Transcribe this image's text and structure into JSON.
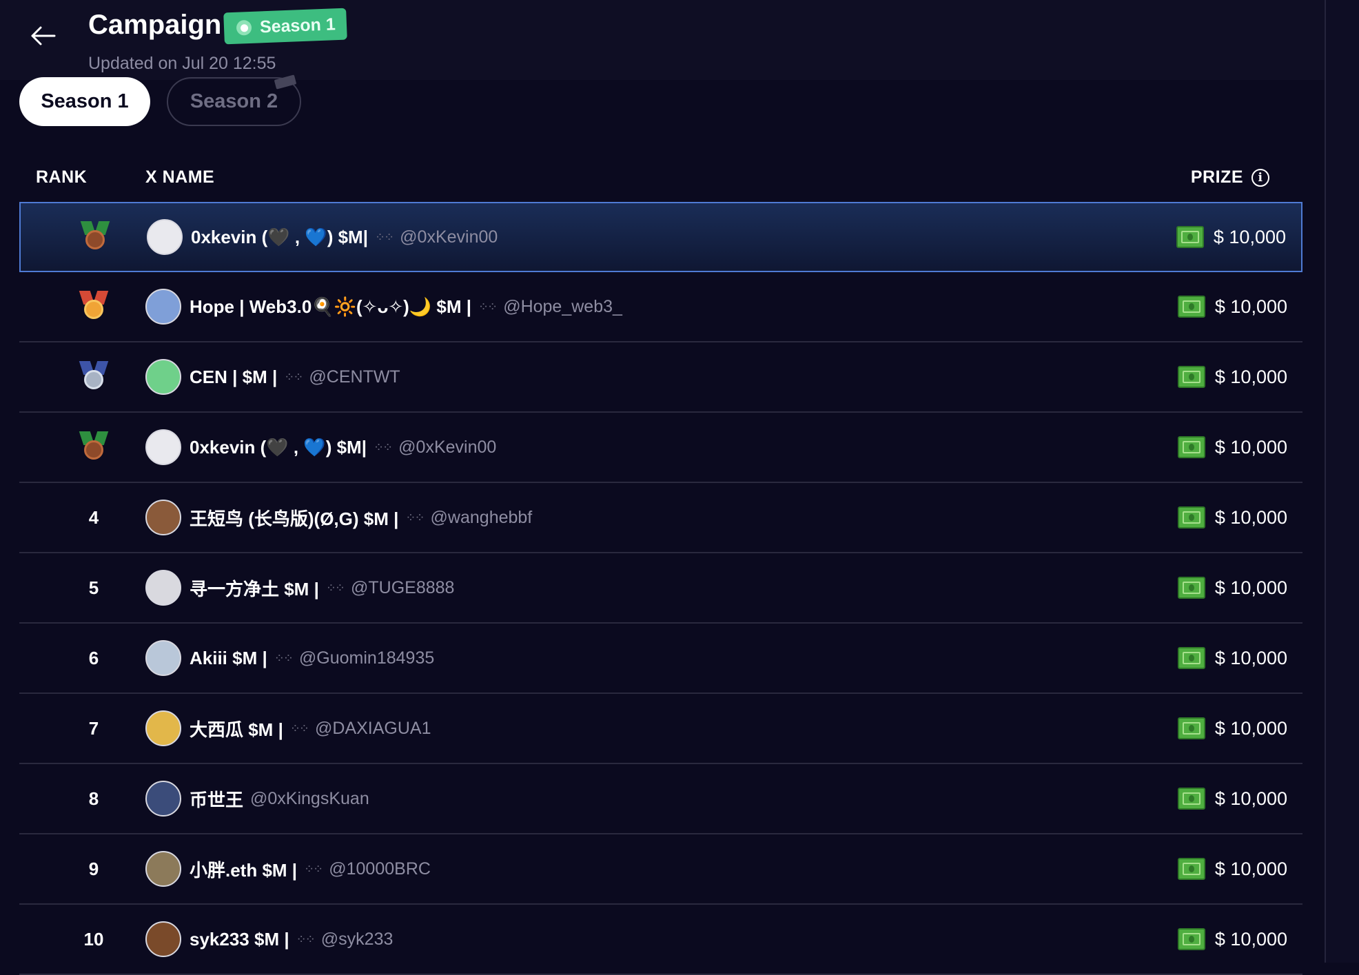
{
  "header": {
    "title": "Campaign",
    "badge": "Season 1",
    "updated": "Updated on Jul 20 12:55"
  },
  "tabs": [
    {
      "label": "Season 1",
      "active": true
    },
    {
      "label": "Season 2",
      "active": false
    }
  ],
  "table": {
    "columns": {
      "rank": "RANK",
      "name": "X NAME",
      "prize": "PRIZE"
    },
    "rows": [
      {
        "rank": "",
        "medal": "bronze",
        "name": "0xkevin (🖤 , 💙) $M|",
        "handle": "@0xKevin00",
        "prize": "$ 10,000",
        "highlight": true,
        "avatar_color": "#e9e9ee"
      },
      {
        "rank": "",
        "medal": "gold",
        "name": "Hope | Web3.0🍳🔆(✧ᴗ✧)🌙 $M |",
        "handle": "@Hope_web3_",
        "prize": "$ 10,000",
        "avatar_color": "#7f9fd8"
      },
      {
        "rank": "",
        "medal": "silver",
        "name": "CEN | $M |",
        "handle": "@CENTWT",
        "prize": "$ 10,000",
        "avatar_color": "#6fd08a"
      },
      {
        "rank": "",
        "medal": "bronze",
        "name": "0xkevin (🖤 , 💙) $M|",
        "handle": "@0xKevin00",
        "prize": "$ 10,000",
        "avatar_color": "#e9e9ee"
      },
      {
        "rank": "4",
        "name": "王短鸟 (长鸟版)(Ø,G) $M |",
        "handle": "@wanghebbf",
        "prize": "$ 10,000",
        "avatar_color": "#8a5a3a"
      },
      {
        "rank": "5",
        "name": "寻一方净土 $M |",
        "handle": "@TUGE8888",
        "prize": "$ 10,000",
        "avatar_color": "#d9d9df"
      },
      {
        "rank": "6",
        "name": "Akiii $M |",
        "handle": "@Guomin184935",
        "prize": "$ 10,000",
        "avatar_color": "#b9c7d9"
      },
      {
        "rank": "7",
        "name": "大西瓜 $M |",
        "handle": "@DAXIAGUA1",
        "prize": "$ 10,000",
        "avatar_color": "#e2b74a"
      },
      {
        "rank": "8",
        "name": "币世王",
        "handle": "@0xKingsKuan",
        "prize": "$ 10,000",
        "avatar_color": "#3b4c7a"
      },
      {
        "rank": "9",
        "name": "小胖.eth $M |",
        "handle": "@10000BRC",
        "prize": "$ 10,000",
        "avatar_color": "#8c7a5a"
      },
      {
        "rank": "10",
        "name": "syk233 $M |",
        "handle": "@syk233",
        "prize": "$ 10,000",
        "avatar_color": "#7a4a2a"
      }
    ]
  },
  "colors": {
    "background": "#0b0a1f",
    "badge_green": "#3dbd80",
    "highlight_border": "#4f7bd4",
    "cash_green": "#4fae40"
  },
  "icons": {
    "back": "arrow-left-icon",
    "info": "info-icon",
    "prize": "cash-icon"
  }
}
